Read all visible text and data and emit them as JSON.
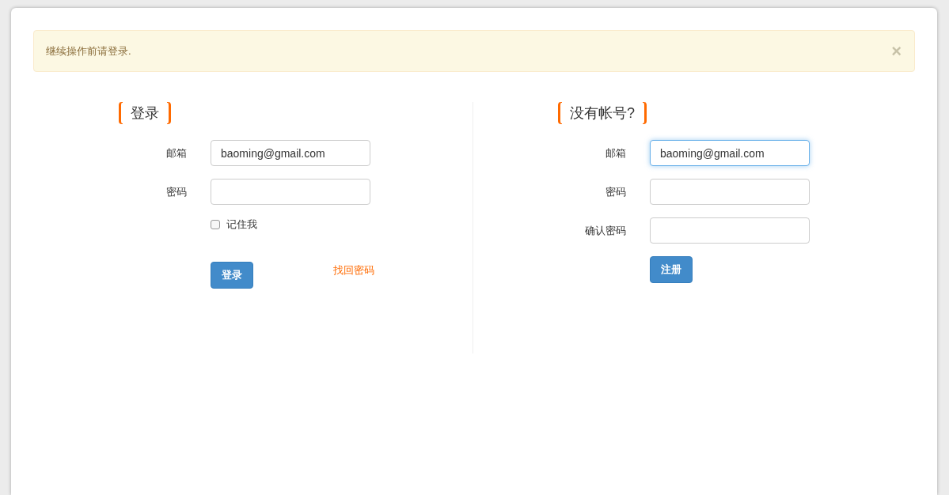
{
  "alert": {
    "message": "继续操作前请登录.",
    "close": "×"
  },
  "login": {
    "title": "登录",
    "fields": [
      {
        "label": "邮箱",
        "value": "baoming@gmail.com",
        "focused": false
      },
      {
        "label": "密码",
        "focused": false
      }
    ],
    "remember": {
      "label": "记住我",
      "checked": false
    },
    "submit": "登录",
    "forgot": "找回密码"
  },
  "register": {
    "title": "没有帐号?",
    "fields": [
      {
        "label": "邮箱",
        "value": "baoming@gmail.com",
        "focused": true
      },
      {
        "label": "密码",
        "focused": false
      },
      {
        "label": "确认密码",
        "focused": false
      }
    ],
    "submit": "注册"
  }
}
